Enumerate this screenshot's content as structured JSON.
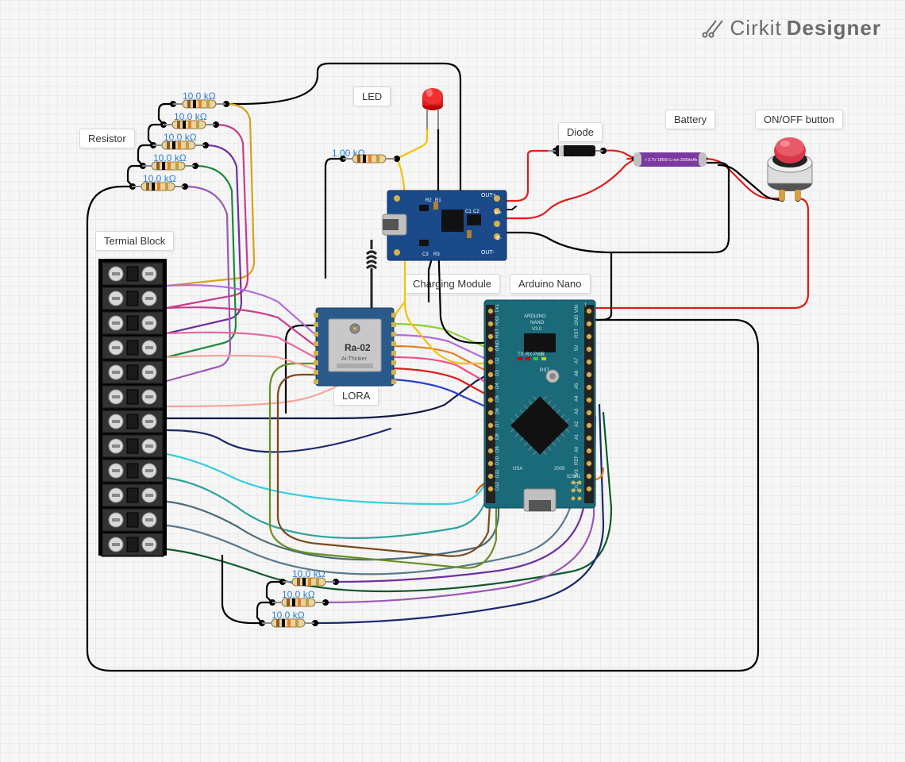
{
  "brand": {
    "name1": "Cirkit",
    "name2": "Designer"
  },
  "labels": {
    "led": "LED",
    "diode": "Diode",
    "battery": "Battery",
    "onoff": "ON/OFF button",
    "resistor": "Resistor",
    "terminal": "Termial Block",
    "lora": "LORA",
    "charging": "Charging Module",
    "arduino": "Arduino Nano"
  },
  "resistor_values": {
    "r_top_1": "10.0 kΩ",
    "r_top_2": "10.0 kΩ",
    "r_top_3": "10.0 kΩ",
    "r_top_4": "10.0 kΩ",
    "r_top_5": "10.0 kΩ",
    "r_led": "1.00 kΩ",
    "r_bot_1": "10.0 kΩ",
    "r_bot_2": "10.0 kΩ",
    "r_bot_3": "10.0 kΩ"
  },
  "charging_module": {
    "out_plus": "OUT+",
    "out_minus": "OUT-",
    "b_plus": "B+",
    "b_minus": "B-",
    "r1": "R1",
    "r2": "R2",
    "r3": "R3",
    "c1": "C1",
    "c2": "C2",
    "c3": "C3"
  },
  "arduino": {
    "title1": "ARDUINO",
    "title2": "NANO",
    "title3": "V3.0",
    "pins_left_top": [
      "TX1",
      "RX0",
      "RST",
      "GND",
      "D2",
      "D3",
      "D4",
      "D5",
      "D6",
      "D7",
      "D8",
      "D9",
      "D10",
      "D11",
      "D12"
    ],
    "pins_right_top": [
      "VIN",
      "GND",
      "RST",
      "5V",
      "A7",
      "A6",
      "A5",
      "A4",
      "A3",
      "A2",
      "A1",
      "A0",
      "REF",
      "3V3",
      "D13"
    ],
    "leds": [
      "TX",
      "RX",
      "PWR",
      "L"
    ],
    "rst": "RST",
    "usa": "USA",
    "year": "2009",
    "icsp": "ICSP1",
    "arrow": "1"
  },
  "lora": {
    "chip": "Ra-02",
    "brand": "Ai-Thinker"
  },
  "battery": {
    "text": "+ 3.7V 18650 Li-ion 2500mAh"
  },
  "wire_colors": {
    "black": "#000000",
    "red": "#e01b1b",
    "yellow": "#f2c200",
    "gold": "#d3a11f",
    "blue": "#2b3fd0",
    "navy": "#1a2a6c",
    "darknavy": "#131c48",
    "green": "#1b8a3a",
    "darkgreen": "#0e5a2c",
    "teal": "#2aa39a",
    "cyan": "#37cde0",
    "lightblue": "#6eb6e6",
    "pink": "#e66aa0",
    "magenta": "#c83c8c",
    "hotpink": "#f04d8a",
    "purple": "#7030a0",
    "violet": "#9b59b6",
    "orchid": "#b36ae2",
    "orange": "#e67e22",
    "darkorange": "#d35400",
    "salmon": "#f5a49b",
    "brown": "#7a4a1c",
    "olive": "#6b8e23",
    "slate": "#4a6b7a",
    "steel": "#5a7a8a",
    "lime": "#8bd13a",
    "grey": "#888888"
  }
}
